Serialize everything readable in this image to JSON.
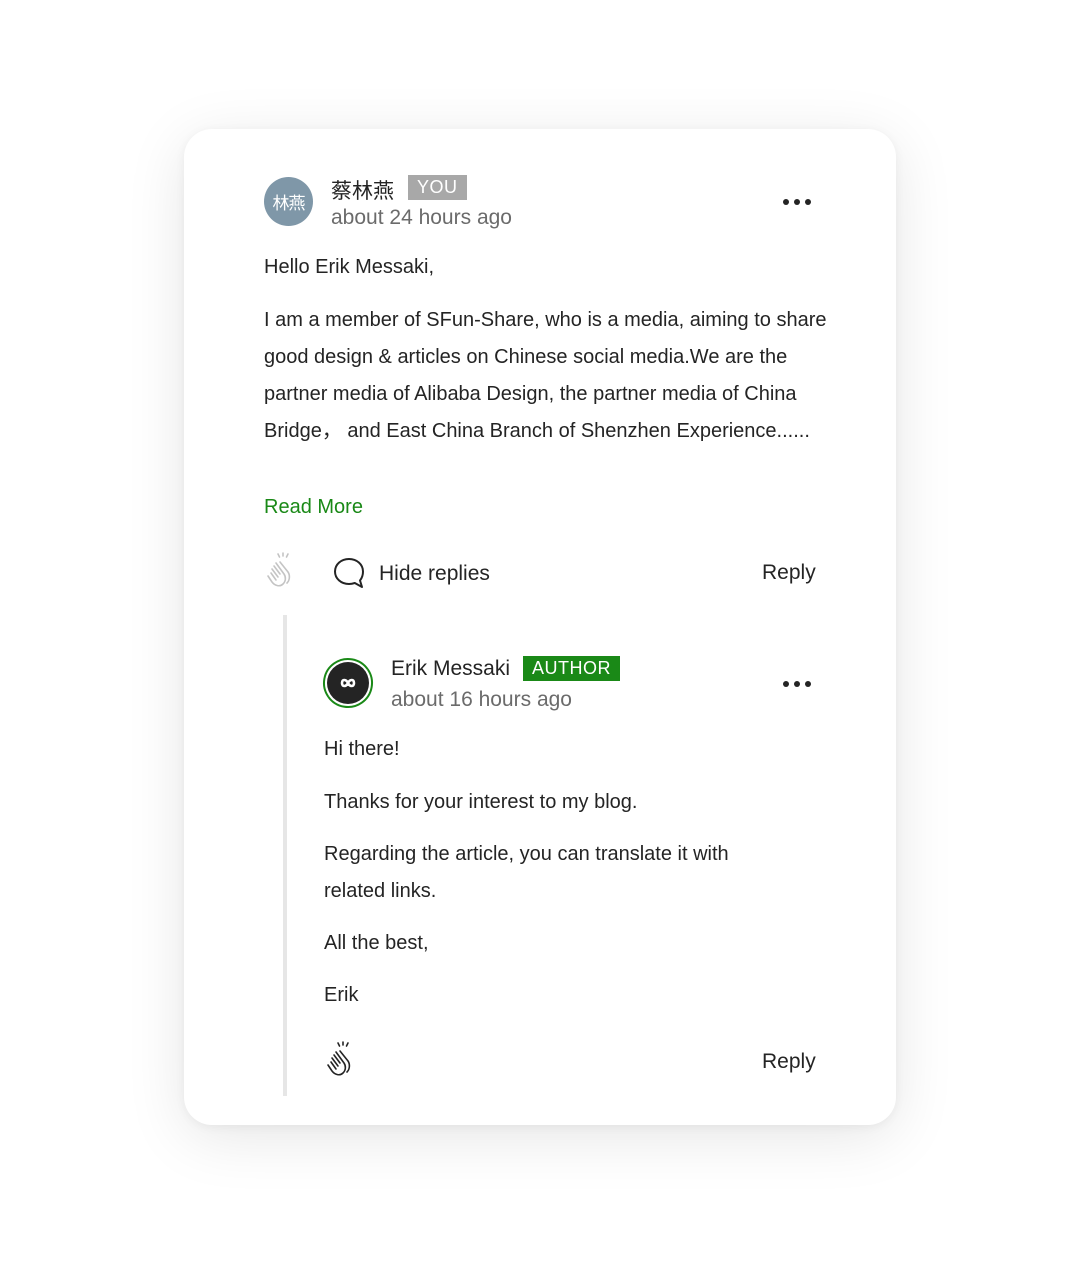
{
  "comment": {
    "avatar_text": "林燕",
    "author": "蔡林燕",
    "badge": "YOU",
    "timestamp": "about 24 hours ago",
    "greeting": "Hello Erik Messaki,",
    "body": "I am a member of SFun-Share, who is a media, aiming to share good design & articles on Chinese social media.We are the partner media of Alibaba Design, the partner media of China Bridge， and East China Branch of Shenzhen Experience......",
    "read_more": "Read More",
    "hide_replies": "Hide replies",
    "reply": "Reply"
  },
  "reply_comment": {
    "author": "Erik Messaki",
    "badge": "AUTHOR",
    "timestamp": "about 16 hours ago",
    "paragraphs": [
      "Hi there!",
      "Thanks for your interest to my blog.",
      "Regarding the article, you can translate it with related links.",
      "All the best,",
      "Erik"
    ],
    "reply": "Reply"
  },
  "colors": {
    "accent_green": "#1a8917",
    "you_badge": "#a8a8a8",
    "avatar_bg": "#7f97a8"
  },
  "icons": {
    "more": "more-horizontal-icon",
    "clap": "clap-icon",
    "comment": "speech-bubble-icon"
  }
}
